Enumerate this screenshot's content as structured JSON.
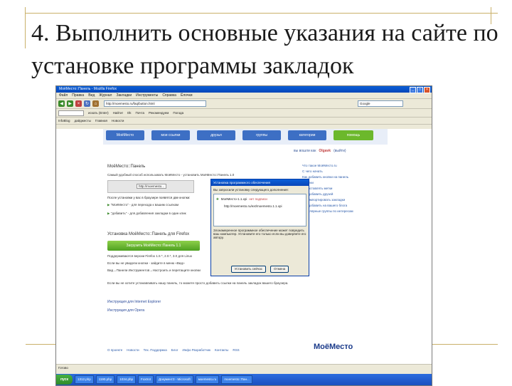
{
  "slide": {
    "title": "4. Выполнить основные указания на сайте по установке программы закладок"
  },
  "browser": {
    "window_title": "МоёМесто::Панель - Mozilla Firefox",
    "menu": [
      "Файл",
      "Правка",
      "Вид",
      "Журнал",
      "Закладки",
      "Инструменты",
      "Справка",
      "Ёлочки"
    ],
    "address": "http://moemesto.ru/faq/button.html",
    "search_placeholder": "Google",
    "toolbar2": [
      "искать (Enter)",
      "Найти!",
      "Ok",
      "Почта",
      "Рекомендуем",
      "Погода"
    ],
    "bookmarks": [
      "InfoBlog",
      "дайджесты",
      "Главная",
      "Новости"
    ],
    "status": "Готово"
  },
  "site": {
    "tabs": [
      "МоёМесто",
      "мои ссылки",
      "друзья",
      "группы",
      "категории",
      "помощь"
    ],
    "user_bar": {
      "prefix": "вы вошли как",
      "user": "Olgavk",
      "logout": "(выйти)"
    },
    "section_title": "МоёМесто::Панель",
    "desc": "Самый удобный способ использовать МоёМесто - установить МоёМесто::Панель 1.0",
    "mini_address": "http://moemesto...",
    "after_install": "После установки у вас в браузере появятся две кнопки:",
    "bullet1": "\"МоёМесто\" - для перехода к вашим ссылкам",
    "bullet2": "\"добавить\" - для добавления закладки в один клик",
    "install_title": "Установка МоёМесто::Панель для Firefox",
    "install_button": "Загрузить МоёМесто::Панель 1.1",
    "line1": "Поддерживаются версии Firefox 1.5 *, 2.0.*, 3.0 для Linux",
    "line2": "Если вы не увидели кнопки - зайдите в меню «Вид»",
    "line3": "Вид→Панели Инструментов→Настроить и перетащите кнопки",
    "line4": "Если вы не хотите устанавливать нашу панель, то можете просто добавить ссылки на панель закладок вашего браузера.",
    "ie_link": "Инструкция для Internet Explorer",
    "opera_link": "Инструкция для Opera",
    "sidebar_links": [
      "Что такое МоёМесто.ru",
      "С чего начать",
      "Как добавить кнопки на панель",
      "Ссылки",
      "Как вставлять метки",
      "Как добавить друзей",
      "Как импортировать закладки",
      "Как добавить на вашего блога",
      "Популярные группы по интересам"
    ],
    "footer_links": [
      "О проекте",
      "Новости",
      "Тех. Поддержка",
      "Блог",
      "Инфо Разработчик",
      "Контакты",
      "RSS"
    ],
    "footer_logo": "МоёМесто"
  },
  "dialog": {
    "title": "Установка программного обеспечения",
    "message": "Вы запросили установку следующего дополнения:",
    "item_name": "МоёМесто-1.1.xpi",
    "item_status": "нет подписи",
    "item_url": "http://moemesto.ru/ext/moemesto.1.1.xpi",
    "warning": "Злонамеренное программное обеспечение может повредить ваш компьютер. Установите его только если вы доверяете его автору.",
    "install_button": "Установить сейчас",
    "cancel_button": "Отмена"
  },
  "taskbar": {
    "start": "пуск",
    "items": [
      "1312.php",
      "1190.php",
      "1034.php",
      "Foxtrot",
      "Документ3 - Microsoft",
      "мoemesto.ru",
      "moemesto::Пан..."
    ]
  },
  "colors": {
    "tab_blue": "#3d6fc4",
    "tab_green": "#6cb82c",
    "dialog_blue": "#0a5fd8",
    "install_green": "#4ea021"
  }
}
